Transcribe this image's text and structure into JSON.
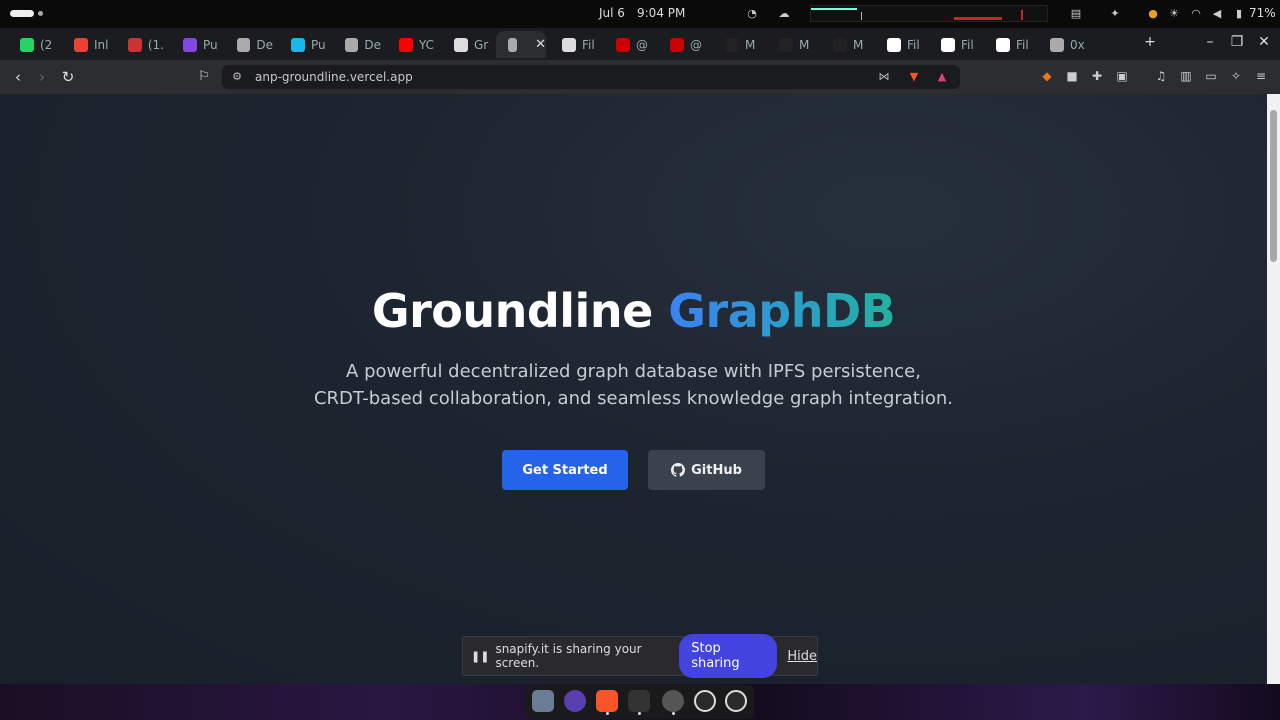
{
  "system": {
    "date": "Jul 6",
    "time": "9:04 PM",
    "battery": "71%"
  },
  "tabs": [
    {
      "label": "(2",
      "icon": "whatsapp-icon",
      "color": "#25d366"
    },
    {
      "label": "Inl",
      "icon": "gmail-icon",
      "color": "#ea4335"
    },
    {
      "label": "(1.",
      "icon": "app-icon",
      "color": "#c33"
    },
    {
      "label": "Pu",
      "icon": "polygon-icon",
      "color": "#8247e5"
    },
    {
      "label": "De",
      "icon": "code-icon",
      "color": "#aaa"
    },
    {
      "label": "Pu",
      "icon": "vimeo-icon",
      "color": "#1ab7ea"
    },
    {
      "label": "De",
      "icon": "code-icon",
      "color": "#aaa"
    },
    {
      "label": "YC",
      "icon": "youtube-icon",
      "color": "#ff0000"
    },
    {
      "label": "Gr",
      "icon": "openai-icon",
      "color": "#ddd"
    },
    {
      "label": "",
      "icon": "globe-icon",
      "color": "#aaa"
    },
    {
      "label": "Fil",
      "icon": "openai-icon",
      "color": "#ddd"
    },
    {
      "label": "@",
      "icon": "notion-icon",
      "color": "#c00"
    },
    {
      "label": "@",
      "icon": "notion-icon",
      "color": "#c00"
    },
    {
      "label": "M",
      "icon": "diamond-icon",
      "color": "#222"
    },
    {
      "label": "M",
      "icon": "diamond-icon",
      "color": "#222"
    },
    {
      "label": "M",
      "icon": "diamond-icon",
      "color": "#222"
    },
    {
      "label": "Fil",
      "icon": "vercel-icon",
      "color": "#fff"
    },
    {
      "label": "Fil",
      "icon": "vercel-icon",
      "color": "#fff"
    },
    {
      "label": "Fil",
      "icon": "vercel-icon",
      "color": "#fff"
    },
    {
      "label": "0x",
      "icon": "globe-icon",
      "color": "#aaa"
    }
  ],
  "address_bar": {
    "url": "anp-groundline.vercel.app"
  },
  "hero": {
    "title_main": "Groundline",
    "title_accent": "GraphDB",
    "subtitle_line1": "A powerful decentralized graph database with IPFS persistence,",
    "subtitle_line2": "CRDT-based collaboration, and seamless knowledge graph integration.",
    "primary_button": "Get Started",
    "secondary_button": "GitHub"
  },
  "share_banner": {
    "message": "snapify.it is sharing your screen.",
    "stop_label": "Stop sharing",
    "hide_label": "Hide"
  },
  "colors": {
    "primary_button": "#2563eb",
    "accent_gradient_start": "#3b82f6",
    "accent_gradient_end": "#22b3a0",
    "stop_sharing": "#4343e0"
  }
}
